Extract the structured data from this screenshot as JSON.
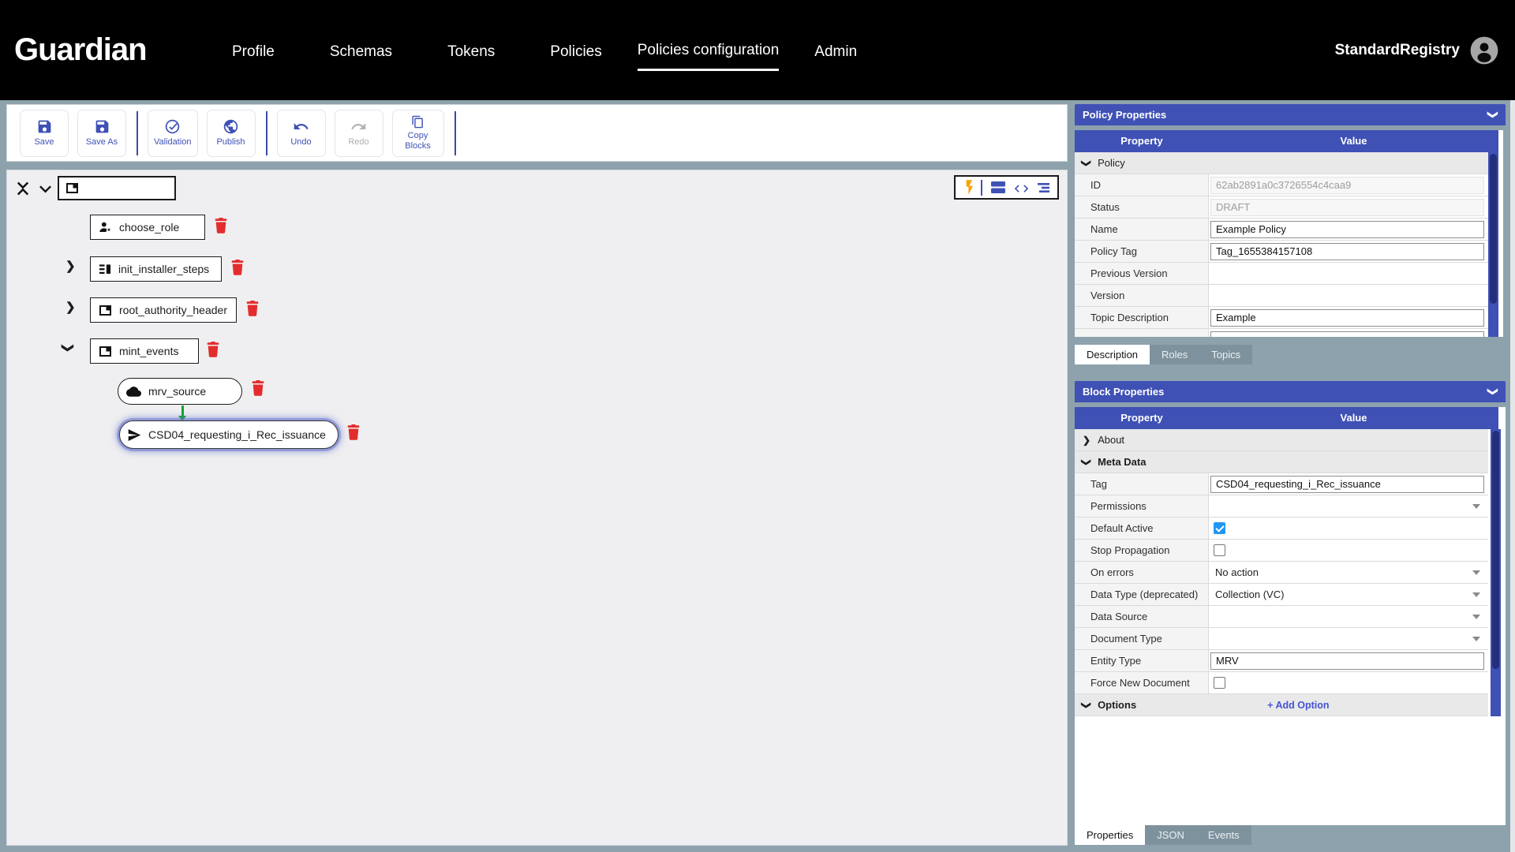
{
  "colors": {
    "accent_indigo": "#3f51b5",
    "header_bg": "#000000",
    "page_bg": "#8da2ac",
    "trash_red": "#e32d2d",
    "checkbox_blue": "#2196f3",
    "lightning_orange": "#f5a300",
    "green_arrow": "#12a32e",
    "selected_glow": "#6573ca",
    "scrollbar_thumb": "#232e7d"
  },
  "icons": {
    "save": "floppy-disk",
    "validation": "check-circle",
    "publish": "globe",
    "undo": "undo-arrow",
    "redo": "redo-arrow",
    "copy_blocks": "copy",
    "user": "account-circle",
    "tree_collapse": "unfold-less",
    "container": "container-square",
    "choose_role": "person-role",
    "steps": "list-steps",
    "cloud": "cloud",
    "send": "send-arrow",
    "delete": "trash-can",
    "view_lightning": "lightning-bolt",
    "view_blocks": "stacked-blocks",
    "view_code": "code-brackets",
    "view_tree": "tree-lines"
  },
  "header": {
    "logo": "Guardian",
    "nav": [
      "Profile",
      "Schemas",
      "Tokens",
      "Policies",
      "Policies configuration",
      "Admin"
    ],
    "active_nav": "Policies configuration",
    "username": "StandardRegistry"
  },
  "toolbar": {
    "save": "Save",
    "save_as": "Save As",
    "validation": "Validation",
    "publish": "Publish",
    "undo": "Undo",
    "redo": "Redo",
    "copy_blocks": "Copy Blocks"
  },
  "canvas": {
    "blocks": [
      {
        "tag": "choose_role",
        "shape": "rect",
        "selected": false
      },
      {
        "tag": "init_installer_steps",
        "shape": "rect",
        "collapsed": true,
        "selected": false
      },
      {
        "tag": "root_authority_header",
        "shape": "rect",
        "collapsed": true,
        "selected": false
      },
      {
        "tag": "mint_events",
        "shape": "rect",
        "expanded": true,
        "selected": false
      },
      {
        "tag": "mrv_source",
        "shape": "pill",
        "parent": "mint_events",
        "selected": false
      },
      {
        "tag": "CSD04_requesting_i_Rec_issuance",
        "shape": "pill",
        "parent": "mint_events",
        "selected": true
      }
    ]
  },
  "policy_properties": {
    "title": "Policy Properties",
    "col_property": "Property",
    "col_value": "Value",
    "group": "Policy",
    "id_label": "ID",
    "id_value": "62ab2891a0c3726554c4caa9",
    "status_label": "Status",
    "status_value": "DRAFT",
    "name_label": "Name",
    "name_value": "Example Policy",
    "tag_label": "Policy Tag",
    "tag_value": "Tag_1655384157108",
    "prev_version_label": "Previous Version",
    "version_label": "Version",
    "topic_label": "Topic Description",
    "topic_value": "Example"
  },
  "policy_tabs": {
    "active": "Description",
    "items": [
      "Description",
      "Roles",
      "Topics"
    ]
  },
  "block_properties": {
    "title": "Block Properties",
    "col_property": "Property",
    "col_value": "Value",
    "about_group": "About",
    "meta_group": "Meta Data",
    "tag_label": "Tag",
    "tag_value": "CSD04_requesting_i_Rec_issuance",
    "permissions_label": "Permissions",
    "default_active_label": "Default Active",
    "default_active_checked": true,
    "stop_propagation_label": "Stop Propagation",
    "stop_propagation_checked": false,
    "on_errors_label": "On errors",
    "on_errors_value": "No action",
    "data_type_label": "Data Type (deprecated)",
    "data_type_value": "Collection (VC)",
    "data_source_label": "Data Source",
    "document_type_label": "Document Type",
    "entity_type_label": "Entity Type",
    "entity_type_value": "MRV",
    "force_new_label": "Force New Document",
    "force_new_checked": false,
    "options_group": "Options",
    "add_option": "+ Add Option"
  },
  "bottom_tabs": {
    "active": "Properties",
    "items": [
      "Properties",
      "JSON",
      "Events"
    ]
  }
}
